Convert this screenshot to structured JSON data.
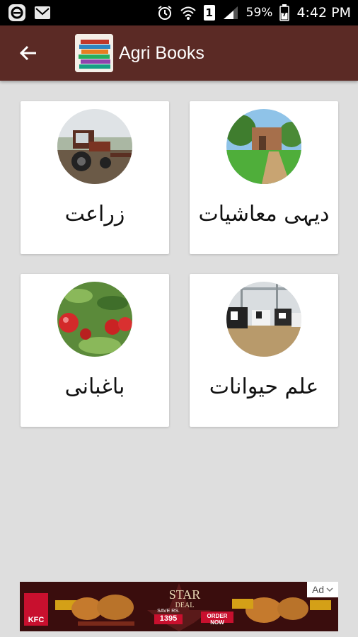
{
  "status_bar": {
    "battery": "59%",
    "time": "4:42 PM",
    "sim": "1"
  },
  "app_bar": {
    "title": "Agri Books"
  },
  "categories": [
    {
      "label": "زراعت",
      "image": "tractor-photo"
    },
    {
      "label": "دیہی معاشیات",
      "image": "rural-house-photo"
    },
    {
      "label": "باغبانی",
      "image": "apples-photo"
    },
    {
      "label": "علم حیوانات",
      "image": "cows-photo"
    }
  ],
  "ad": {
    "tag": "Ad",
    "brand": "KFC",
    "headline": "STAR",
    "subline": "DEAL",
    "price": "1395",
    "price_prefix": "SAVE RS.",
    "cta": "ORDER NOW"
  },
  "colors": {
    "app_bar": "#5b2a25",
    "background": "#dedede",
    "card": "#ffffff"
  }
}
